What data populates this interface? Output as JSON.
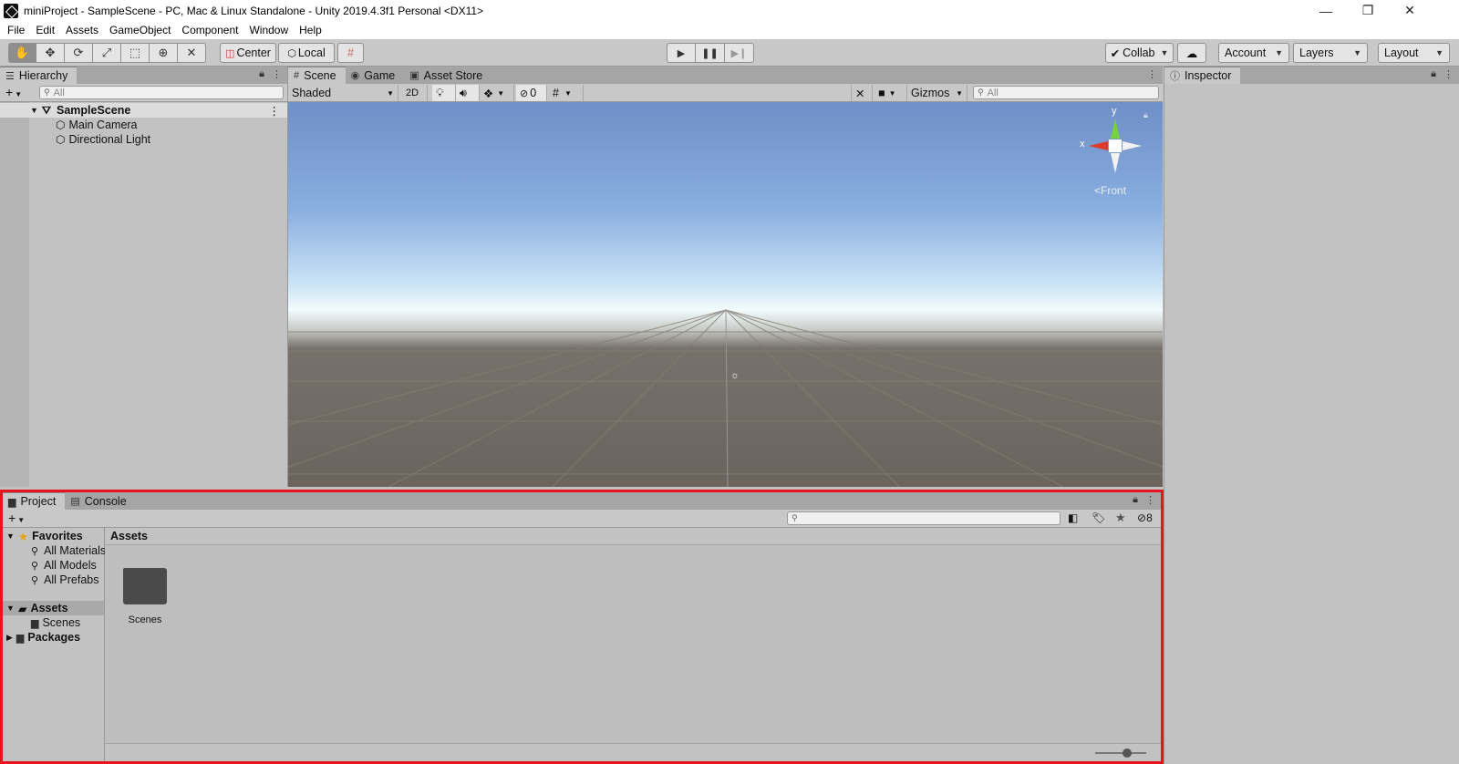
{
  "window": {
    "title": "miniProject - SampleScene - PC, Mac & Linux Standalone - Unity 2019.4.3f1 Personal <DX11>",
    "controls": [
      "—",
      "❐",
      "✕"
    ]
  },
  "menu": [
    "File",
    "Edit",
    "Assets",
    "GameObject",
    "Component",
    "Window",
    "Help"
  ],
  "toolbar": {
    "tools": [
      "hand-icon",
      "move-icon",
      "rotate-icon",
      "scale-icon",
      "rect-icon",
      "transform-icon",
      "custom-tool-icon"
    ],
    "pivot_label": "Center",
    "space_label": "Local",
    "collab_label": "Collab",
    "account_label": "Account",
    "layers_label": "Layers",
    "layout_label": "Layout"
  },
  "hierarchy": {
    "tab_label": "Hierarchy",
    "search_placeholder": "All",
    "scene_name": "SampleScene",
    "items": [
      "Main Camera",
      "Directional Light"
    ]
  },
  "scene_view": {
    "tabs": [
      "Scene",
      "Game",
      "Asset Store"
    ],
    "shading_mode": "Shaded",
    "mode_2d": "2D",
    "hidden_count": "0",
    "gizmos_label": "Gizmos",
    "search_placeholder": "All",
    "gizmo_axis_x": "x",
    "gizmo_axis_y": "y",
    "view_label": "Front"
  },
  "inspector": {
    "tab_label": "Inspector"
  },
  "project": {
    "tabs": [
      "Project",
      "Console"
    ],
    "hidden_count": "8",
    "favorites_label": "Favorites",
    "favorites": [
      "All Materials",
      "All Models",
      "All Prefabs"
    ],
    "assets_label": "Assets",
    "asset_children": [
      "Scenes"
    ],
    "packages_label": "Packages",
    "breadcrumb": "Assets",
    "folders": [
      "Scenes"
    ]
  },
  "colors": {
    "selection_outline": "#e8141c",
    "play_gizmo_green": "#77d13a",
    "gizmo_red": "#e03a2b"
  }
}
